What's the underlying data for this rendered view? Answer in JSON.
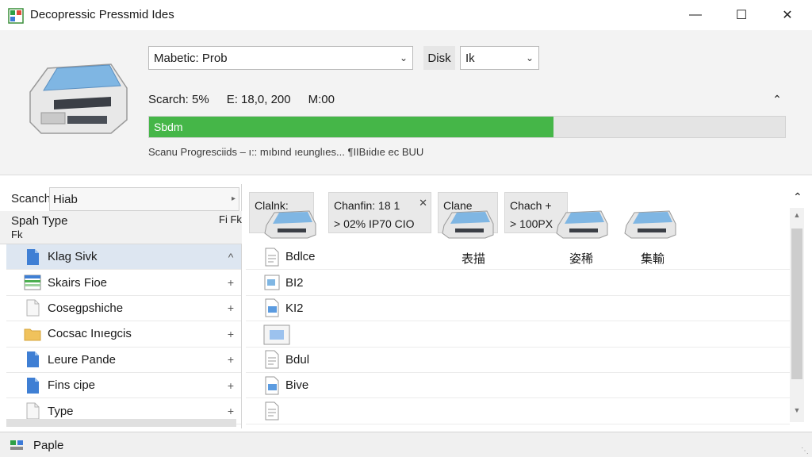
{
  "window": {
    "title": "Decopressic Pressmid Ides",
    "minimize_glyph": "—",
    "maximize_glyph": "☐",
    "close_glyph": "✕"
  },
  "toolbar": {
    "mode_value": "Mabetic: Prob",
    "disk_label": "Disk",
    "disk_value": "Ik"
  },
  "scan": {
    "search_stat": "Scarch: 5%",
    "e_stat": "E: 18,0, 200",
    "m_stat": "M:00",
    "progress_fraction": 0.636,
    "progress_label": "Sbdm",
    "caption": "Scanu Progresciids – ı:: mıbınd ıeunglıes... ¶IIBıidıe ec BUU",
    "progress_color": "#45b648"
  },
  "left": {
    "search_label": "Scanch:",
    "search_value": "Hiab",
    "type_header": "Spah Type",
    "type_sub": "Fk",
    "type_header_icon": "Fi Fk",
    "items": [
      {
        "label": "Klag Sivk",
        "icon": "blue-doc-icon",
        "action": "^"
      },
      {
        "label": "Skairs Fioe",
        "icon": "spreadsheet-icon",
        "action": "+"
      },
      {
        "label": "Cosegpshiche",
        "icon": "blank-doc-icon",
        "action": "+"
      },
      {
        "label": "Cocsac Inıegcis",
        "icon": "folder-icon",
        "action": "+"
      },
      {
        "label": "Leure Pande",
        "icon": "blue-doc-icon",
        "action": "+"
      },
      {
        "label": "Fins cipe",
        "icon": "blue-doc-icon",
        "action": "+"
      },
      {
        "label": "Type",
        "icon": "blank-doc-icon",
        "action": "+"
      }
    ]
  },
  "right": {
    "chips": [
      {
        "line1": "Clalnk:",
        "line2": ""
      },
      {
        "line1": "Chanfin: 18  1",
        "line2": "> 02%  IP70 CIO",
        "close": "✕"
      },
      {
        "line1": "Clane",
        "line2": ""
      },
      {
        "line1": "Chach +",
        "line2": "> 100PX"
      }
    ],
    "files": [
      {
        "name": "Bdlce",
        "c2": "表描",
        "c3": "姿稀",
        "c4": "集輸",
        "icon": "text-file-icon"
      },
      {
        "name": "BI2",
        "c2": "",
        "c3": "",
        "c4": "",
        "icon": "image-file-icon"
      },
      {
        "name": "KI2",
        "c2": "",
        "c3": "",
        "c4": "",
        "icon": "blue-file-icon"
      },
      {
        "name": "",
        "c2": "",
        "c3": "",
        "c4": "",
        "icon": "preview-file-icon"
      },
      {
        "name": "Bdul",
        "c2": "",
        "c3": "",
        "c4": "",
        "icon": "text-file-icon"
      },
      {
        "name": "Bive",
        "c2": "",
        "c3": "",
        "c4": "",
        "icon": "blue-file-icon"
      },
      {
        "name": "",
        "c2": "",
        "c3": "",
        "c4": "",
        "icon": "text-file-icon"
      }
    ]
  },
  "status": {
    "text": "Paple"
  }
}
